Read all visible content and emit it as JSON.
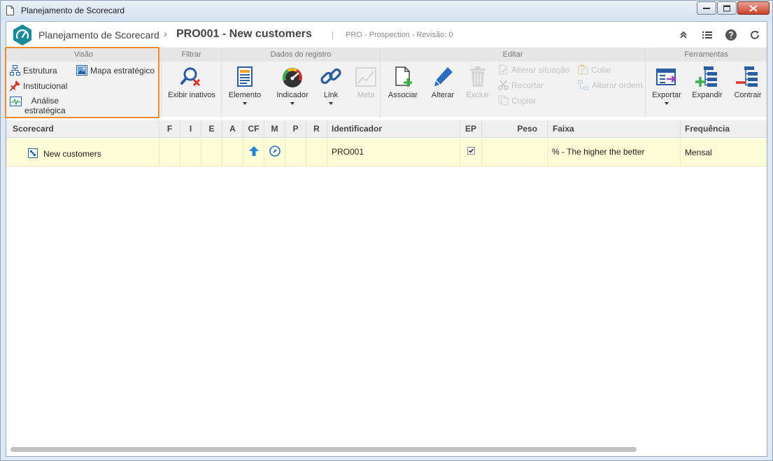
{
  "window": {
    "title": "Planejamento de Scorecard"
  },
  "header": {
    "app_title": "Planejamento de Scorecard",
    "separator": "›",
    "record_title": "PRO001 - New customers",
    "pipe": "|",
    "subtitle": "PRO - Prospection - Revisão: 0",
    "icons": [
      "collapse-up-icon",
      "list-icon",
      "help-icon",
      "refresh-icon"
    ]
  },
  "ribbon": {
    "groups": {
      "visao": {
        "title": "Visão",
        "items": {
          "estrutura": "Estrutura",
          "mapa": "Mapa estratégico",
          "institucional": "Institucional",
          "analise_l1": "Análise",
          "analise_l2": "estratégica"
        }
      },
      "filtrar": {
        "title": "Filtrar",
        "exibir_inativos": "Exibir inativos"
      },
      "dados": {
        "title": "Dados do registro",
        "elemento": "Elemento",
        "indicador": "Indicador",
        "link": "Link",
        "meta": "Meta"
      },
      "editar": {
        "title": "Editar",
        "associar": "Associar",
        "alterar": "Alterar",
        "excluir": "Excluir",
        "alterar_situacao": "Alterar situação",
        "recortar": "Recortar",
        "copiar": "Copiar",
        "colar": "Colar",
        "alterar_ordem": "Alterar ordem"
      },
      "ferramentas": {
        "title": "Ferramentas",
        "exportar": "Exportar",
        "expandir": "Expandir",
        "contrair": "Contrair"
      }
    }
  },
  "table": {
    "columns": {
      "scorecard": "Scorecard",
      "f": "F",
      "i": "I",
      "e": "E",
      "a": "A",
      "cf": "CF",
      "m": "M",
      "p": "P",
      "r": "R",
      "identificador": "Identificador",
      "ep": "EP",
      "peso": "Peso",
      "faixa": "Faixa",
      "frequencia": "Frequência"
    },
    "rows": [
      {
        "scorecard": "New customers",
        "identificador": "PRO001",
        "ep_checked": true,
        "peso": "",
        "faixa": "% - The higher the better",
        "frequencia": "Mensal"
      }
    ]
  },
  "colors": {
    "accent": "#1a8a9a",
    "highlight": "#ef8a2e",
    "row_selected": "#fdfcd6",
    "arrow_blue": "#1e88d8"
  }
}
